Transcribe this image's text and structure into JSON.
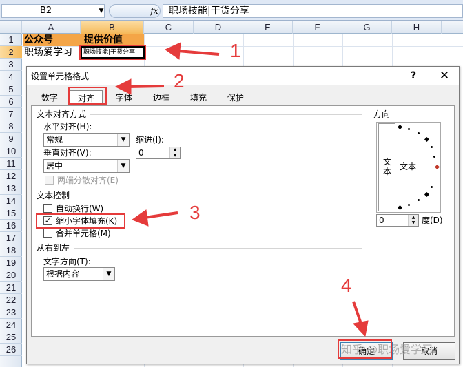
{
  "formula_bar": {
    "name_box": "B2",
    "fx": "fx",
    "formula": "职场技能|干货分享"
  },
  "sheet": {
    "columns": [
      "A",
      "B",
      "C",
      "D",
      "E",
      "F",
      "G",
      "H"
    ],
    "rows": [
      "1",
      "2",
      "3",
      "4",
      "5",
      "6",
      "7",
      "8",
      "9",
      "10",
      "11",
      "12",
      "13",
      "14",
      "15",
      "16",
      "17",
      "18",
      "19",
      "20",
      "21",
      "22",
      "23",
      "24",
      "25",
      "26"
    ],
    "cells": {
      "a1": "公众号",
      "b1": "提供价值",
      "a2": "职场爱学习",
      "b2": "职场技能|干货分享"
    }
  },
  "dialog": {
    "title": "设置单元格格式",
    "help": "?",
    "close": "✕",
    "tabs": [
      "数字",
      "对齐",
      "字体",
      "边框",
      "填充",
      "保护"
    ],
    "active_tab": "对齐",
    "text_alignment": {
      "header": "文本对齐方式",
      "horizontal_label": "水平对齐(H):",
      "horizontal_value": "常规",
      "indent_label": "缩进(I):",
      "indent_value": "0",
      "vertical_label": "垂直对齐(V):",
      "vertical_value": "居中",
      "justify_distributed": "两端分散对齐(E)"
    },
    "text_control": {
      "header": "文本控制",
      "wrap_text": "自动换行(W)",
      "shrink_to_fit": "缩小字体填充(K)",
      "merge_cells": "合并单元格(M)"
    },
    "rtl": {
      "header": "从右到左",
      "direction_label": "文字方向(T):",
      "direction_value": "根据内容"
    },
    "orientation": {
      "header": "方向",
      "vertical_text": "文本",
      "horizontal_text": "文本",
      "degree_value": "0",
      "degree_label": "度(D)"
    },
    "ok": "确定",
    "cancel": "取消"
  },
  "annotations": {
    "n1": "1",
    "n2": "2",
    "n3": "3",
    "n4": "4"
  },
  "watermark": "知乎 @职场爱学习",
  "colors": {
    "header_fill": "#f4a547",
    "annotation_red": "#e53b3b",
    "selected_header": "#f5b95a"
  }
}
